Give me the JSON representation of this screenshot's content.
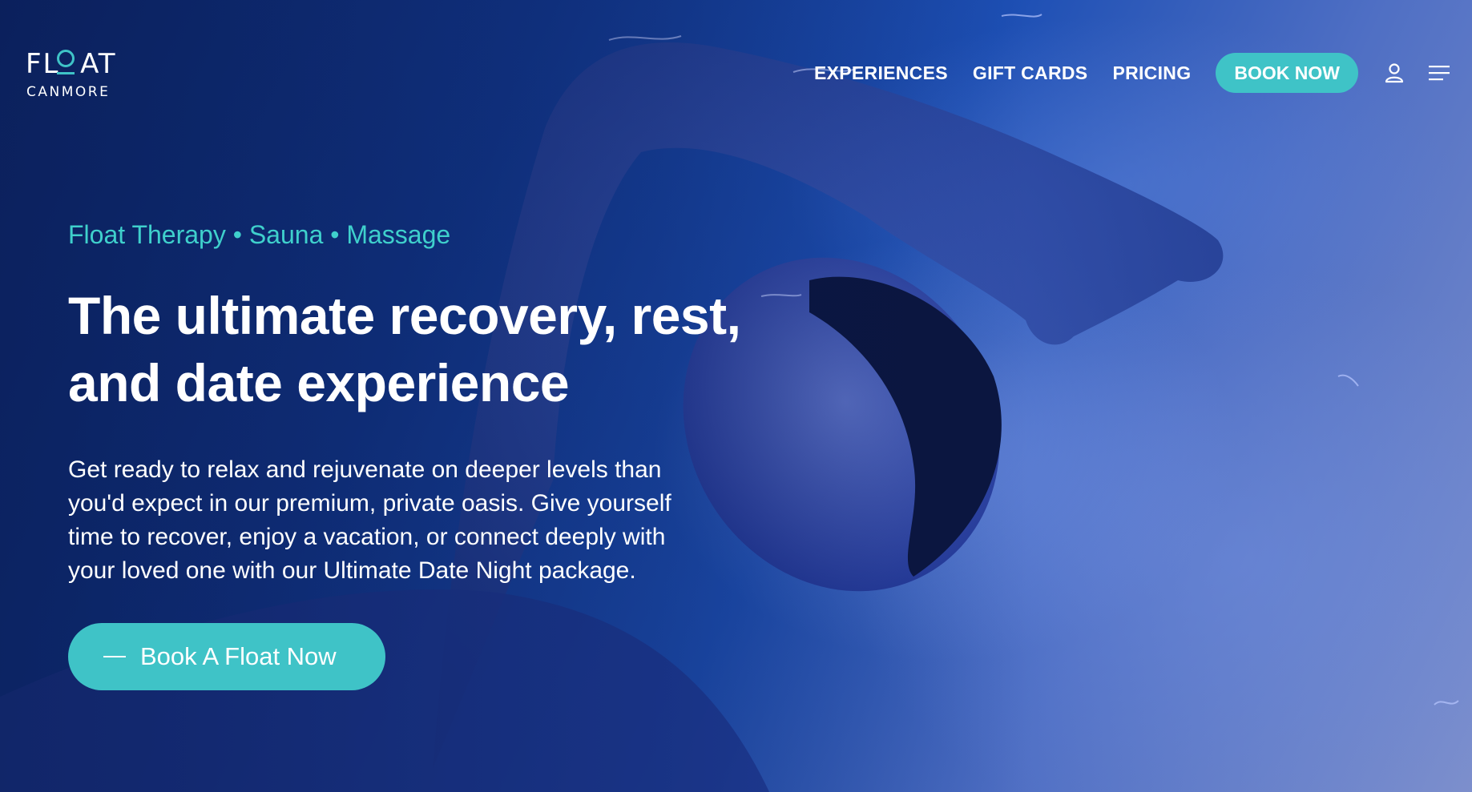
{
  "brand": {
    "logo_text": "FL  AT",
    "logo_sub": "CANMORE",
    "accent_color": "#3fc3c7",
    "tagline_color": "#3fd0cc"
  },
  "nav": {
    "links": [
      "EXPERIENCES",
      "GIFT CARDS",
      "PRICING"
    ],
    "book_label": "BOOK NOW",
    "account_icon": "user-icon",
    "menu_icon": "hamburger-menu-icon"
  },
  "hero": {
    "tagline": "Float Therapy • Sauna • Massage",
    "headline_lines": [
      "The ultimate recovery, rest,",
      "and date experience"
    ],
    "description_lines": [
      "Get ready to relax and rejuvenate on deeper levels than",
      "you'd expect in our premium, private oasis. Give yourself",
      "time to recover, enjoy a vacation, or connect deeply with",
      "your loved one with our Ultimate Date Night package."
    ],
    "cta_label": "Book A Float Now"
  }
}
